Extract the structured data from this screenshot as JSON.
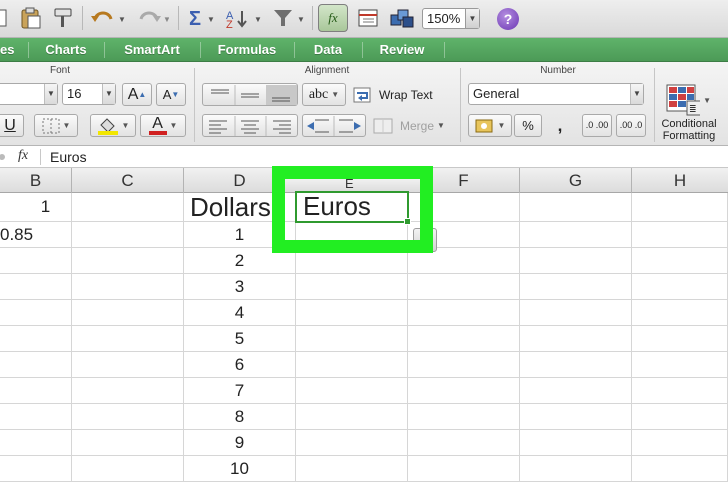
{
  "toolbar": {
    "zoom": "150%",
    "fx_button": "fx",
    "help": "?"
  },
  "ribbon_tabs": [
    "es",
    "Charts",
    "SmartArt",
    "Formulas",
    "Data",
    "Review"
  ],
  "ribbon": {
    "font_group": "Font",
    "font_size": "16",
    "alignment_group": "Alignment",
    "orientation_label": "abc",
    "wrap_text": "Wrap Text",
    "merge": "Merge",
    "number_group": "Number",
    "number_format": "General",
    "percent": "%",
    "comma": ",",
    "increase_decimal": ".0 .00",
    "decrease_decimal": ".00 .0",
    "font_grow": "A",
    "font_shrink": "A",
    "underline": "U",
    "font_color": "A",
    "conditional_formatting": [
      "Conditional",
      "Formatting"
    ]
  },
  "formula_bar": {
    "fx": "fx",
    "value": "Euros"
  },
  "columns": [
    "B",
    "C",
    "D",
    "E",
    "F",
    "G",
    "H"
  ],
  "cells": {
    "b1": "1",
    "b2": "0.85",
    "d1": "Dollars",
    "e1": "Euros",
    "d_values": [
      "1",
      "2",
      "3",
      "4",
      "5",
      "6",
      "7",
      "8",
      "9",
      "10"
    ]
  },
  "colors": {
    "ribbon_green": "#4c9a57",
    "highlight": "#22ee22",
    "selection_border": "#2f9a2f"
  }
}
